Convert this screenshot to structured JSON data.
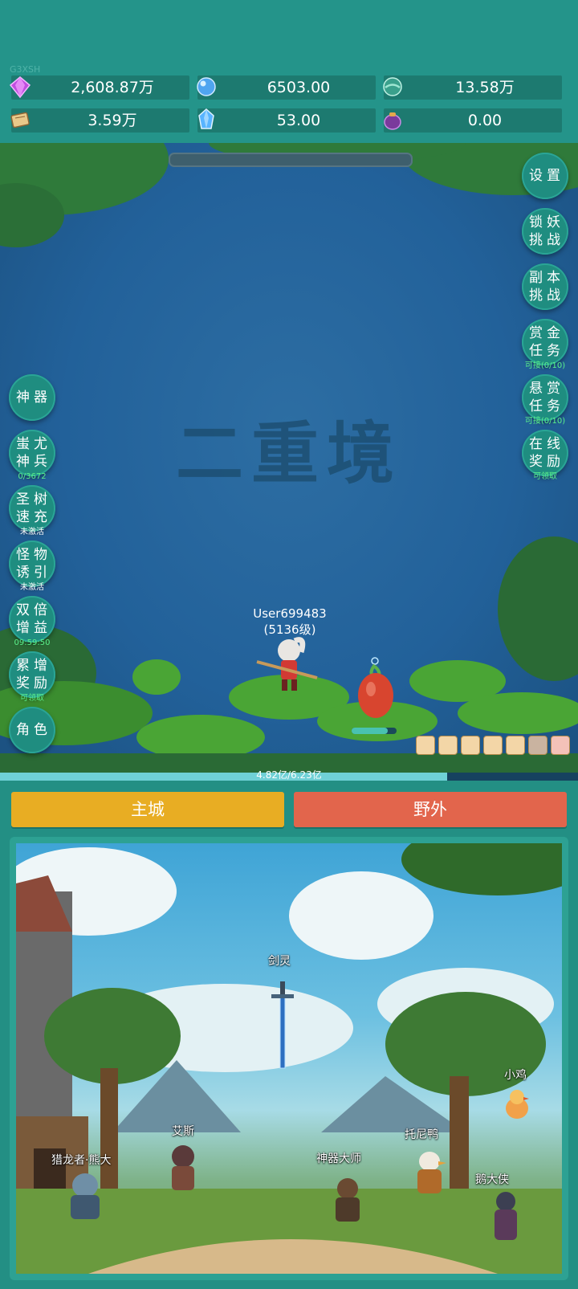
{
  "top": {
    "watermark": "G3XSH",
    "resources": [
      {
        "icon": "purple-diamond-icon",
        "value": "2,608.87万"
      },
      {
        "icon": "blue-orb-icon",
        "value": "6503.00"
      },
      {
        "icon": "teal-orb-icon",
        "value": "13.58万"
      },
      {
        "icon": "scroll-icon",
        "value": "3.59万"
      },
      {
        "icon": "blue-crystal-icon",
        "value": "53.00"
      },
      {
        "icon": "purple-pouch-icon",
        "value": "0.00"
      }
    ]
  },
  "battle": {
    "stage_title": "二重境",
    "player_name": "User699483",
    "player_level": "(5136级)",
    "hp_text": "4.82亿/6.23亿",
    "hp_fraction": 0.7737,
    "left_buttons": [
      {
        "label": "神器",
        "sub": ""
      },
      {
        "label": "蚩尤神兵",
        "sub": "0/3672"
      },
      {
        "label": "圣树速充",
        "sub": "未激活"
      },
      {
        "label": "怪物诱引",
        "sub": "未激活"
      },
      {
        "label": "双倍增益",
        "sub": "09:59:50"
      },
      {
        "label": "累增奖励",
        "sub": "可领取"
      },
      {
        "label": "角色",
        "sub": ""
      }
    ],
    "right_buttons": [
      {
        "label": "设置",
        "sub": ""
      },
      {
        "label": "锁妖挑战",
        "sub": ""
      },
      {
        "label": "副本挑战",
        "sub": ""
      },
      {
        "label": "赏金任务",
        "sub": "可接(0/10)"
      },
      {
        "label": "悬赏任务",
        "sub": "可接(0/10)"
      },
      {
        "label": "在线奖励",
        "sub": "可领取"
      }
    ]
  },
  "tabs": {
    "city": "主城",
    "wild": "野外"
  },
  "colors": {
    "city_tab": "#e8ad23",
    "wild_tab": "#e2654c",
    "sub_green": "#5cf28b"
  },
  "npcs": [
    {
      "name": "剑灵"
    },
    {
      "name": "小鸡"
    },
    {
      "name": "艾斯"
    },
    {
      "name": "托尼鸭"
    },
    {
      "name": "猎龙者·熊大"
    },
    {
      "name": "神器大师"
    },
    {
      "name": "鹅大侠"
    }
  ]
}
